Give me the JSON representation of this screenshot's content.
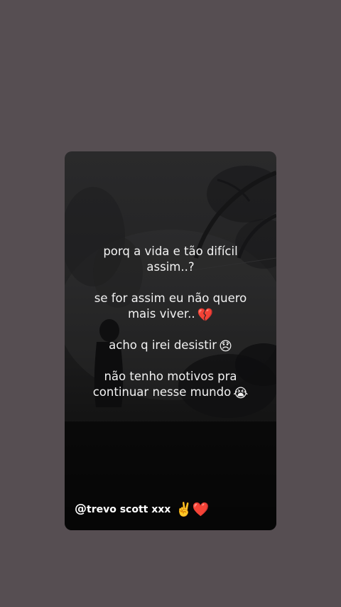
{
  "story": {
    "line1": "porq a vida e tão difícil\nassim..?",
    "line2": "se for assim eu não quero\nmais viver..",
    "line2_emoji": "💔",
    "line3": "acho q irei desistir",
    "line3_emoji": "😞",
    "line4": "não tenho motivos pra\ncontinuar nesse mundo",
    "line4_emoji": "😭",
    "handle_at": "@",
    "handle_name": "trevo scott xxx",
    "handle_emoji": "✌️❤️"
  },
  "colors": {
    "page_background": "#564e52",
    "card_background": "#1c1c1d",
    "text": "#f2f2f2"
  }
}
